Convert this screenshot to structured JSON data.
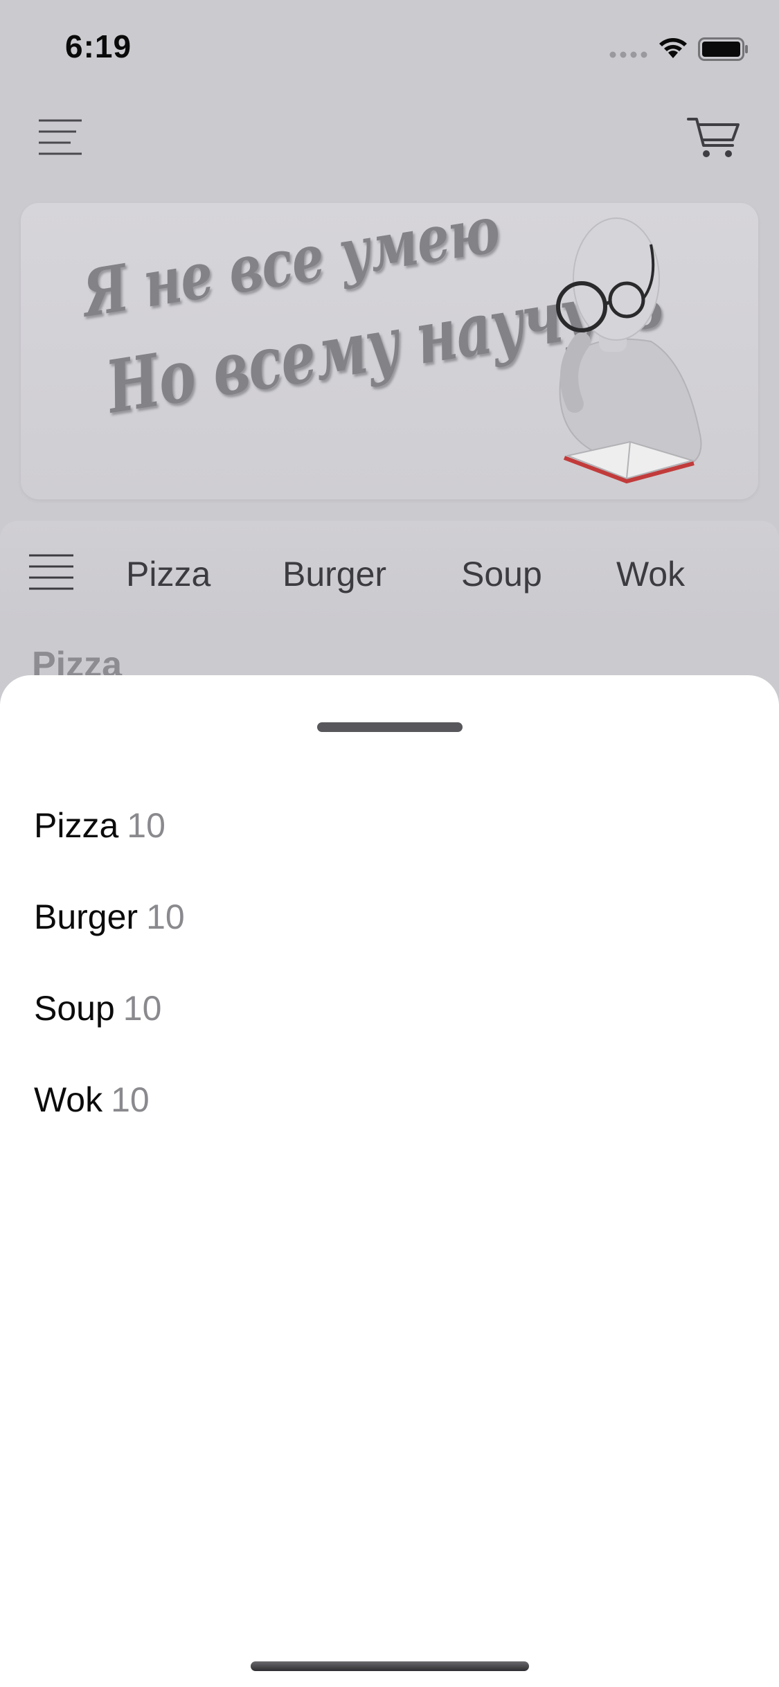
{
  "status_bar": {
    "time": "6:19"
  },
  "header": {
    "menu_icon": "hamburger-menu-icon",
    "cart_icon": "shopping-cart-icon"
  },
  "banner": {
    "line1": "Я не все умею",
    "line2": "Но всему научусь"
  },
  "category_bar": {
    "menu_icon": "hamburger-menu-icon",
    "tabs": [
      {
        "label": "Pizza"
      },
      {
        "label": "Burger"
      },
      {
        "label": "Soup"
      },
      {
        "label": "Wok"
      }
    ]
  },
  "section": {
    "title": "Pizza"
  },
  "sheet": {
    "items": [
      {
        "label": "Pizza",
        "count": "10"
      },
      {
        "label": "Burger",
        "count": "10"
      },
      {
        "label": "Soup",
        "count": "10"
      },
      {
        "label": "Wok",
        "count": "10"
      }
    ]
  },
  "colors": {
    "dim_overlay": "#cbcacf",
    "sheet_background": "#ffffff",
    "count_text": "#8a8a8e",
    "book_cover": "#c23b3b"
  }
}
